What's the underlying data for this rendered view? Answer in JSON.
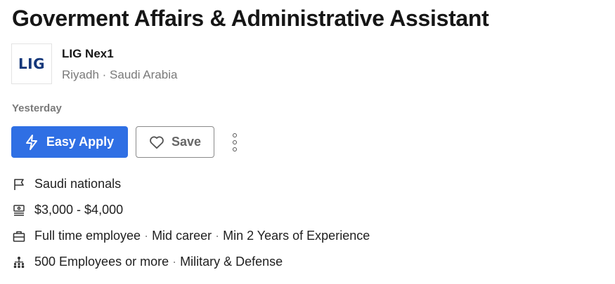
{
  "job": {
    "title": "Goverment Affairs & Administrative Assistant",
    "posted": "Yesterday"
  },
  "company": {
    "logo_text": "LIG",
    "name": "LIG Nex1",
    "location": "Riyadh · Saudi Arabia"
  },
  "actions": {
    "apply_label": "Easy Apply",
    "apply_icon": "lightning-icon",
    "save_label": "Save",
    "save_icon": "heart-icon",
    "more_icon": "more-vertical-icon"
  },
  "details": {
    "nationality": "Saudi nationals",
    "salary": "$3,000 - $4,000",
    "employment": {
      "type": "Full time employee",
      "level": "Mid career",
      "experience": "Min 2 Years of Experience"
    },
    "company_info": {
      "size": "500 Employees or more",
      "industry": "Military & Defense"
    }
  },
  "colors": {
    "primary": "#2f6fe4",
    "logo": "#14377a",
    "muted": "#7a7a7a"
  }
}
